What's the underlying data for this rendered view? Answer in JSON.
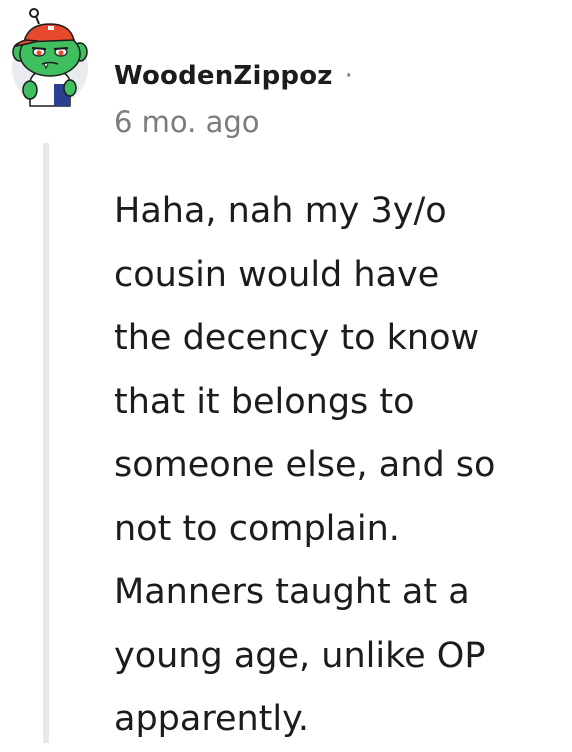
{
  "comment": {
    "author": "WoodenZippoz",
    "separator": "·",
    "timestamp": "6 mo. ago",
    "body_lines": [
      "Haha, nah my 3y/o",
      "cousin would have",
      "the decency to know",
      "that it belongs to",
      "someone else, and so",
      "not to complain.",
      "Manners taught at a",
      "young age, unlike OP",
      "apparently."
    ]
  },
  "avatar": {
    "icon": "snoo-avatar-icon",
    "skin_color": "#3fbf5f",
    "cap_color": "#e8492c",
    "background_color": "#e9ebee"
  },
  "colors": {
    "text": "#1c1c1c",
    "meta": "#7c7c7c",
    "thread_line": "#e6e8eb"
  }
}
